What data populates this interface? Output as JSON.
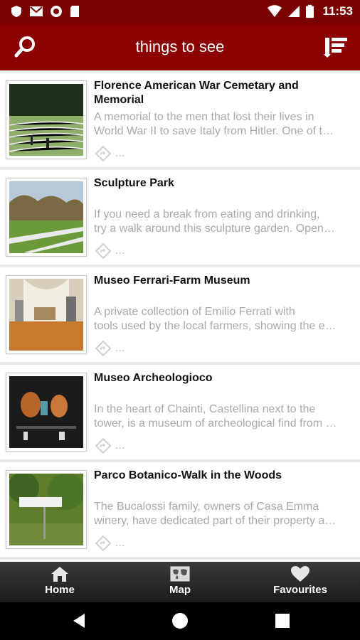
{
  "status_bar": {
    "time": "11:53",
    "left_icons": [
      "shield-icon",
      "gmail-icon",
      "record-icon",
      "sd-card-icon"
    ],
    "right_icons": [
      "wifi-icon",
      "signal-icon",
      "battery-icon"
    ]
  },
  "app_bar": {
    "title": "things to see",
    "left_icon": "search-icon",
    "right_icon": "list-sort-icon"
  },
  "items": [
    {
      "title": "Florence American War Cemetary and Memorial",
      "desc_line1": " A memorial to the men that lost their lives in",
      "desc_line2": "World War II to save Italy from Hitler.  One of t…",
      "meta": "..."
    },
    {
      "title": "Sculpture Park",
      "desc_line1": " If you need a break from eating and drinking,",
      "desc_line2": "try a walk around this sculpture garden.  Open…",
      "meta": "..."
    },
    {
      "title": "Museo Ferrari-Farm Museum",
      "desc_line1": " A private collection of Emilio Ferrati with",
      "desc_line2": "tools used by the local farmers, showing the e…",
      "meta": "..."
    },
    {
      "title": "Museo Archeologioco",
      "desc_line1": " In the heart of Chainti, Castellina next to the",
      "desc_line2": "tower, is a museum of archeological find from …",
      "meta": "..."
    },
    {
      "title": "Parco Botanico-Walk in the Woods",
      "desc_line1": " The Bucalossi family, owners of Casa Emma",
      "desc_line2": "winery, have dedicated part of their property a…",
      "meta": "..."
    }
  ],
  "bottom_nav": {
    "home": "Home",
    "map": "Map",
    "favourites": "Favourites"
  },
  "system_nav": [
    "back-icon",
    "home-circle-icon",
    "recents-icon"
  ],
  "colors": {
    "app_bar": "#8b0000",
    "status_bar": "#7a0000"
  }
}
